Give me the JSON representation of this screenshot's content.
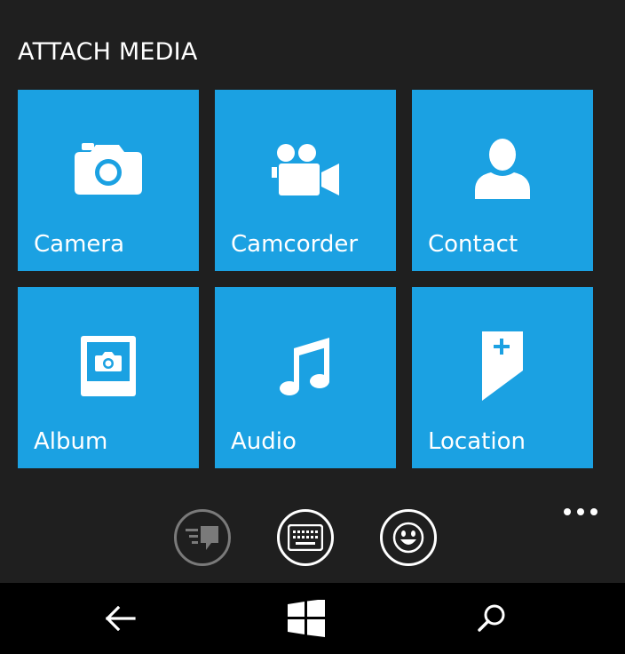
{
  "header": {
    "title": "ATTACH MEDIA"
  },
  "tiles": [
    {
      "label": "Camera",
      "icon": "camera-icon"
    },
    {
      "label": "Camcorder",
      "icon": "camcorder-icon"
    },
    {
      "label": "Contact",
      "icon": "contact-icon"
    },
    {
      "label": "Album",
      "icon": "album-icon"
    },
    {
      "label": "Audio",
      "icon": "music-note-icon"
    },
    {
      "label": "Location",
      "icon": "location-icon"
    }
  ],
  "appbar": {
    "buttons": [
      {
        "icon": "quick-reply-icon",
        "enabled": false
      },
      {
        "icon": "keyboard-icon",
        "enabled": true
      },
      {
        "icon": "emoji-icon",
        "enabled": true
      }
    ],
    "more_icon": "more-dots-icon"
  },
  "navbar": {
    "buttons": [
      "back-arrow-icon",
      "windows-start-icon",
      "search-icon"
    ]
  },
  "colors": {
    "accent": "#1ba1e2",
    "background": "#1f1f1f",
    "navbar": "#000000",
    "text": "#ffffff",
    "disabled": "#7a7a7a"
  }
}
